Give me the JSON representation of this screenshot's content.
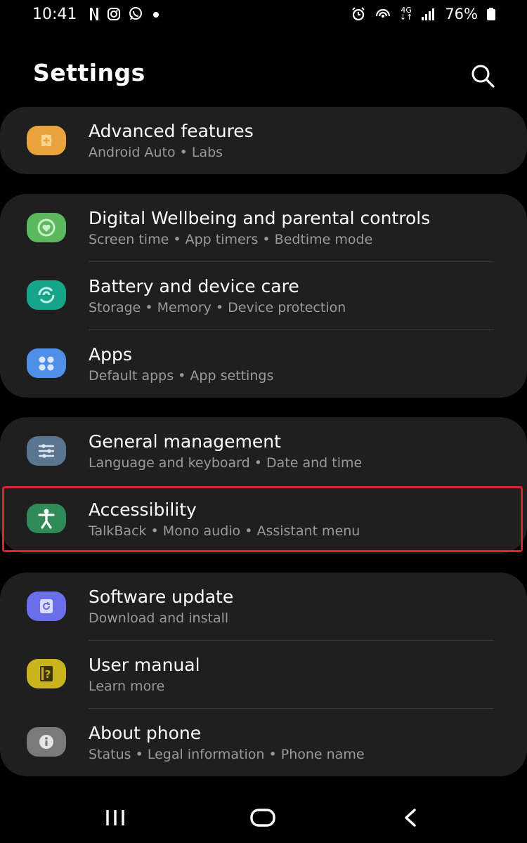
{
  "status_bar": {
    "time": "10:41",
    "battery": "76%",
    "network": "4G"
  },
  "header": {
    "title": "Settings",
    "search_icon": "search-icon"
  },
  "groups": [
    {
      "items": [
        {
          "title": "Advanced features",
          "subtitle": "Android Auto  •  Labs",
          "icon": "puzzle-plus-icon",
          "color": "#e8a33d"
        }
      ]
    },
    {
      "items": [
        {
          "title": "Digital Wellbeing and parental controls",
          "subtitle": "Screen time  •  App timers  •  Bedtime mode",
          "icon": "heart-circle-icon",
          "color": "#5cb85c"
        },
        {
          "title": "Battery and device care",
          "subtitle": "Storage  •  Memory  •  Device protection",
          "icon": "refresh-care-icon",
          "color": "#17a589"
        },
        {
          "title": "Apps",
          "subtitle": "Default apps  •  App settings",
          "icon": "apps-grid-icon",
          "color": "#4f8fe8"
        }
      ]
    },
    {
      "items": [
        {
          "title": "General management",
          "subtitle": "Language and keyboard  •  Date and time",
          "icon": "sliders-icon",
          "color": "#5a7590"
        },
        {
          "title": "Accessibility",
          "subtitle": "TalkBack  •  Mono audio  •  Assistant menu",
          "icon": "accessibility-icon",
          "color": "#2e8b57"
        }
      ]
    },
    {
      "items": [
        {
          "title": "Software update",
          "subtitle": "Download and install",
          "icon": "update-icon",
          "color": "#6a6ee8"
        },
        {
          "title": "User manual",
          "subtitle": "Learn more",
          "icon": "manual-icon",
          "color": "#c9b41c"
        },
        {
          "title": "About phone",
          "subtitle": "Status  •  Legal information  •  Phone name",
          "icon": "info-icon",
          "color": "#7a7a7a"
        }
      ]
    }
  ],
  "nav_bar": {
    "recents": "recents-icon",
    "home": "home-icon",
    "back": "back-icon"
  }
}
